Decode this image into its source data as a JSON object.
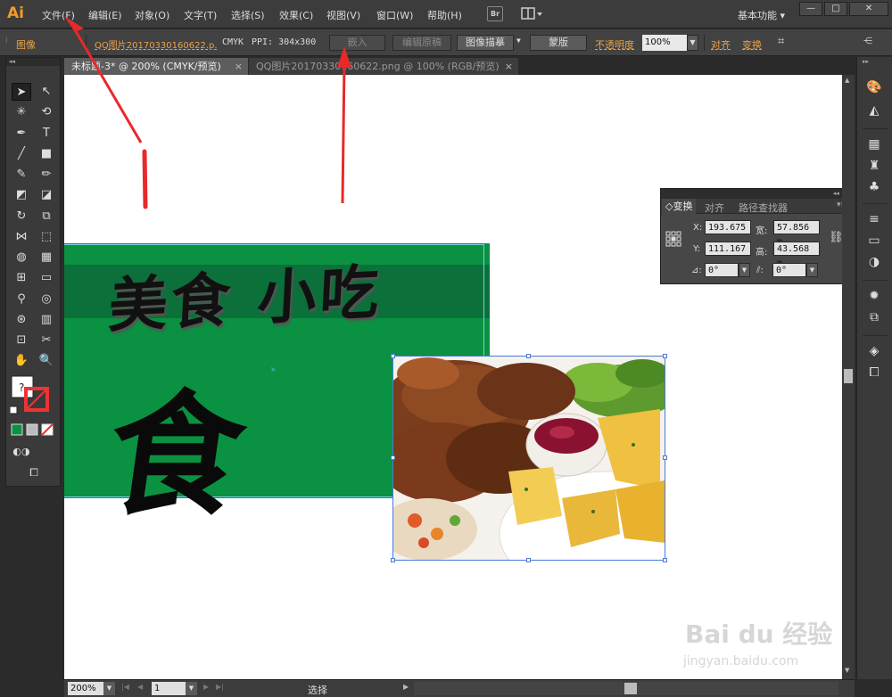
{
  "app": {
    "logo": "Ai",
    "menus": [
      "文件(F)",
      "编辑(E)",
      "对象(O)",
      "文字(T)",
      "选择(S)",
      "效果(C)",
      "视图(V)",
      "窗口(W)",
      "帮助(H)"
    ],
    "bridge_label": "Br",
    "workspace": "基本功能",
    "window_controls": [
      "—",
      "□",
      "✕"
    ]
  },
  "control_bar": {
    "object_type": "图像",
    "file_link": "QQ图片20170330160622.p.",
    "color_mode": "CMYK",
    "ppi": "PPI: 304x300",
    "embed": "嵌入",
    "edit_original": "编辑原稿",
    "image_trace": "图像描摹",
    "mask": "蒙版",
    "opacity_label": "不透明度",
    "opacity_value": "100%",
    "align": "对齐",
    "transform": "变换"
  },
  "tabs": [
    {
      "label": "未标题-3* @ 200% (CMYK/预览)",
      "close": "×"
    },
    {
      "label": "QQ图片20170330160622.png @ 100% (RGB/预览)",
      "close": "×"
    }
  ],
  "artwork": {
    "title": "美食 小吃",
    "big_char": "食"
  },
  "transform_panel": {
    "tabs": [
      "◇变换",
      "对齐",
      "路径查找器"
    ],
    "x_label": "X:",
    "x_value": "193.675",
    "w_label": "宽:",
    "w_value": "57.856 m",
    "y_label": "Y:",
    "y_value": "111.167",
    "h_label": "高:",
    "h_value": "43.568 m",
    "rotate_value": "0°",
    "shear_value": "0°"
  },
  "status_bar": {
    "zoom": "200%",
    "page": "1",
    "tool_status": "选择"
  },
  "watermark": {
    "logo": "Bai du 经验",
    "url": "jingyan.baidu.com"
  },
  "colors": {
    "banner_green": "#0b9142",
    "banner_stripe": "#0b703a",
    "annotation_red": "#e8292b",
    "accent_orange": "#f19b27"
  }
}
